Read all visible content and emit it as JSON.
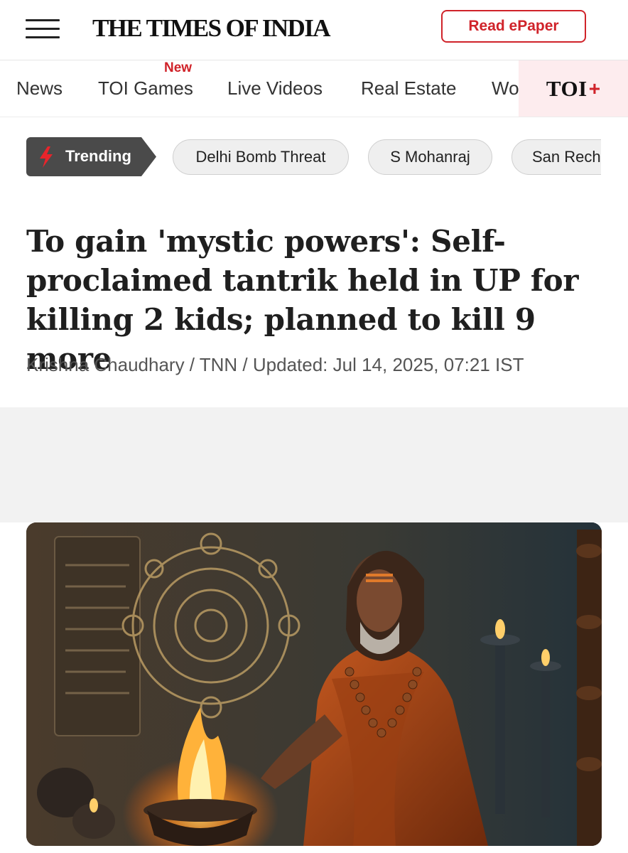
{
  "header": {
    "logo": "THE TIMES OF INDIA",
    "epaper_label": "Read ePaper",
    "menu_icon": "hamburger-menu-icon"
  },
  "nav": {
    "items": [
      {
        "label": "News",
        "badge": ""
      },
      {
        "label": "TOI Games",
        "badge": "New"
      },
      {
        "label": "Live Videos",
        "badge": ""
      },
      {
        "label": "Real Estate",
        "badge": ""
      },
      {
        "label": "Wo",
        "badge": ""
      }
    ],
    "toi_plus": {
      "text": "TOI",
      "mark": "+"
    }
  },
  "trending": {
    "label": "Trending",
    "icon": "lightning-bolt-icon",
    "topics": [
      "Delhi Bomb Threat",
      "S Mohanraj",
      "San Recha"
    ]
  },
  "article": {
    "headline": "To gain 'mystic powers': Self-proclaimed tantrik held in UP for killing 2 kids; planned to kill 9 more",
    "byline": "Krishna Chaudhary / TNN / Updated: Jul 14, 2025, 07:21 IST"
  },
  "colors": {
    "brand_red": "#d0232a",
    "trending_bg": "#4a4a4a",
    "toi_plus_bg": "#fdecee",
    "ad_band_bg": "#f2f2f2"
  }
}
